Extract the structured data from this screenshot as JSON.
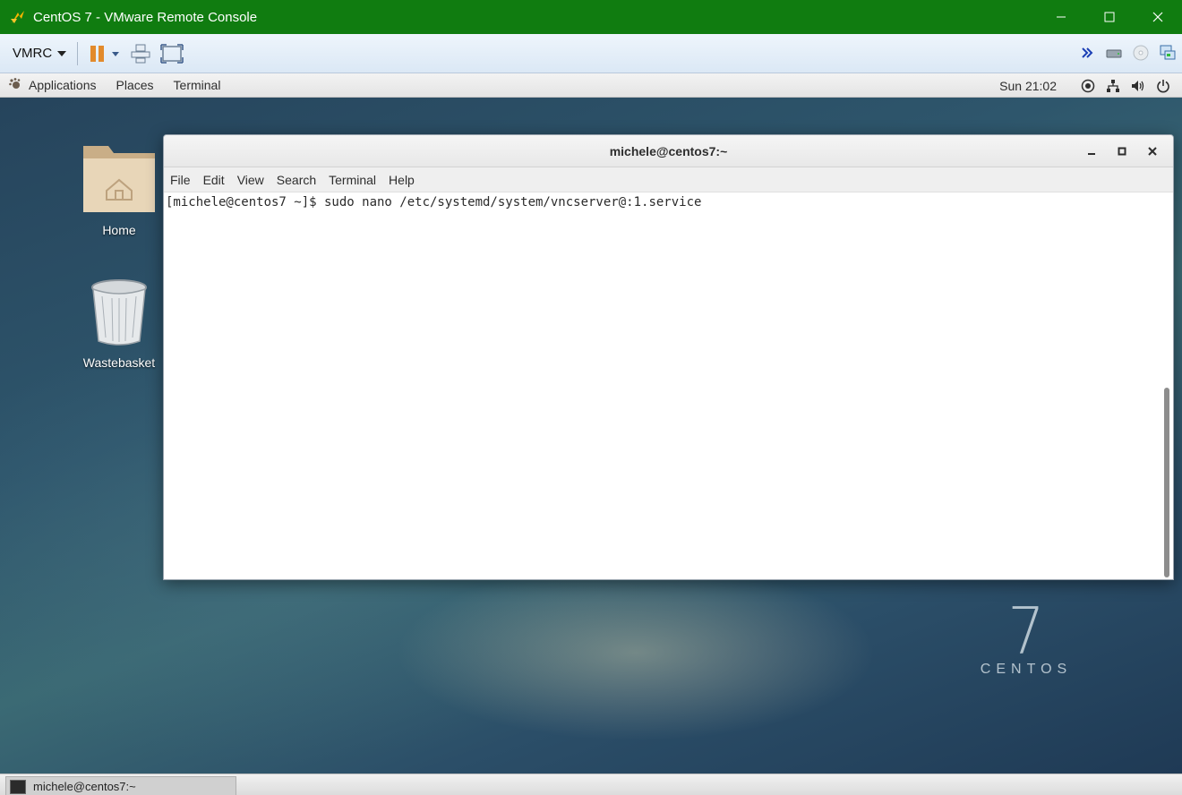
{
  "window": {
    "title": "CentOS 7 - VMware Remote Console"
  },
  "toolbar": {
    "vmrc_label": "VMRC"
  },
  "gnome_bar": {
    "applications": "Applications",
    "places": "Places",
    "terminal": "Terminal",
    "clock": "Sun 21:02"
  },
  "desktop": {
    "icons": [
      {
        "label": "Home"
      },
      {
        "label": "Wastebasket"
      }
    ],
    "logo_number": "7",
    "logo_text": "CENTOS"
  },
  "terminal": {
    "title": "michele@centos7:~",
    "menu": [
      "File",
      "Edit",
      "View",
      "Search",
      "Terminal",
      "Help"
    ],
    "lines": [
      "[michele@centos7 ~]$ sudo nano /etc/systemd/system/vncserver@:1.service"
    ]
  },
  "taskbar": {
    "items": [
      {
        "label": "michele@centos7:~"
      }
    ]
  },
  "colors": {
    "titlebar": "#107c10",
    "toolbar": "#dbe8f5",
    "pause_orange": "#e28a2b"
  }
}
